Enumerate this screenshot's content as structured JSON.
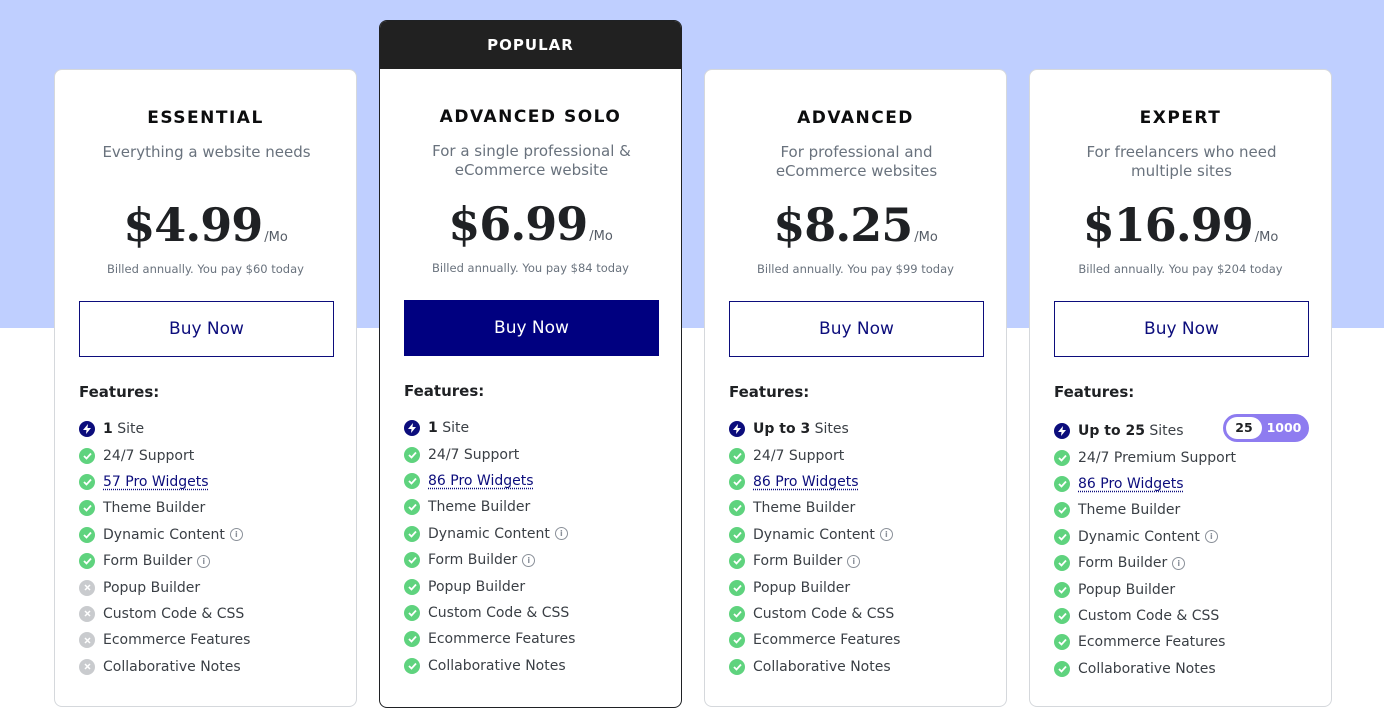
{
  "popular_label": "POPULAR",
  "features_label": "Features:",
  "per_label": "/Mo",
  "buy_label": "Buy Now",
  "colors": {
    "band": "#bfcfff",
    "brand": "#000080",
    "check": "#5fd37e",
    "cross": "#c9cbce",
    "toggle": "#8e7cf0"
  },
  "plans": [
    {
      "name": "ESSENTIAL",
      "desc": "Everything a website needs",
      "price": "$4.99",
      "billed": "Billed annually. You pay $60 today",
      "features": [
        {
          "icon": "bolt",
          "bold": "1",
          "text": " Site"
        },
        {
          "icon": "check",
          "text": "24/7 Support"
        },
        {
          "icon": "check",
          "text": "57 Pro Widgets",
          "link": true
        },
        {
          "icon": "check",
          "text": "Theme Builder"
        },
        {
          "icon": "check",
          "text": "Dynamic Content",
          "info": true
        },
        {
          "icon": "check",
          "text": "Form Builder",
          "info": true
        },
        {
          "icon": "x",
          "text": "Popup Builder"
        },
        {
          "icon": "x",
          "text": "Custom Code & CSS"
        },
        {
          "icon": "x",
          "text": "Ecommerce Features"
        },
        {
          "icon": "x",
          "text": "Collaborative Notes"
        }
      ]
    },
    {
      "name": "ADVANCED SOLO",
      "desc": "For a single professional & eCommerce website",
      "price": "$6.99",
      "billed": "Billed annually. You pay $84 today",
      "popular": true,
      "features": [
        {
          "icon": "bolt",
          "bold": "1",
          "text": " Site"
        },
        {
          "icon": "check",
          "text": "24/7 Support"
        },
        {
          "icon": "check",
          "text": "86 Pro Widgets",
          "link": true
        },
        {
          "icon": "check",
          "text": "Theme Builder"
        },
        {
          "icon": "check",
          "text": "Dynamic Content",
          "info": true
        },
        {
          "icon": "check",
          "text": "Form Builder",
          "info": true
        },
        {
          "icon": "check",
          "text": "Popup Builder"
        },
        {
          "icon": "check",
          "text": "Custom Code & CSS"
        },
        {
          "icon": "check",
          "text": "Ecommerce Features"
        },
        {
          "icon": "check",
          "text": "Collaborative Notes"
        }
      ]
    },
    {
      "name": "ADVANCED",
      "desc": "For professional and eCommerce websites",
      "price": "$8.25",
      "billed": "Billed annually. You pay $99 today",
      "features": [
        {
          "icon": "bolt",
          "bold": "Up to 3",
          "text": " Sites"
        },
        {
          "icon": "check",
          "text": "24/7 Support"
        },
        {
          "icon": "check",
          "text": "86 Pro Widgets",
          "link": true
        },
        {
          "icon": "check",
          "text": "Theme Builder"
        },
        {
          "icon": "check",
          "text": "Dynamic Content",
          "info": true
        },
        {
          "icon": "check",
          "text": "Form Builder",
          "info": true
        },
        {
          "icon": "check",
          "text": "Popup Builder"
        },
        {
          "icon": "check",
          "text": "Custom Code & CSS"
        },
        {
          "icon": "check",
          "text": "Ecommerce Features"
        },
        {
          "icon": "check",
          "text": "Collaborative Notes"
        }
      ]
    },
    {
      "name": "EXPERT",
      "desc": "For freelancers who need multiple sites",
      "price": "$16.99",
      "billed": "Billed annually. You pay $204 today",
      "toggle": {
        "selected": "25",
        "other": "1000"
      },
      "features": [
        {
          "icon": "bolt",
          "bold": "Up to 25",
          "text": " Sites"
        },
        {
          "icon": "check",
          "text": "24/7 Premium Support"
        },
        {
          "icon": "check",
          "text": "86 Pro Widgets",
          "link": true
        },
        {
          "icon": "check",
          "text": "Theme Builder"
        },
        {
          "icon": "check",
          "text": "Dynamic Content",
          "info": true
        },
        {
          "icon": "check",
          "text": "Form Builder",
          "info": true
        },
        {
          "icon": "check",
          "text": "Popup Builder"
        },
        {
          "icon": "check",
          "text": "Custom Code & CSS"
        },
        {
          "icon": "check",
          "text": "Ecommerce Features"
        },
        {
          "icon": "check",
          "text": "Collaborative Notes"
        }
      ]
    }
  ]
}
